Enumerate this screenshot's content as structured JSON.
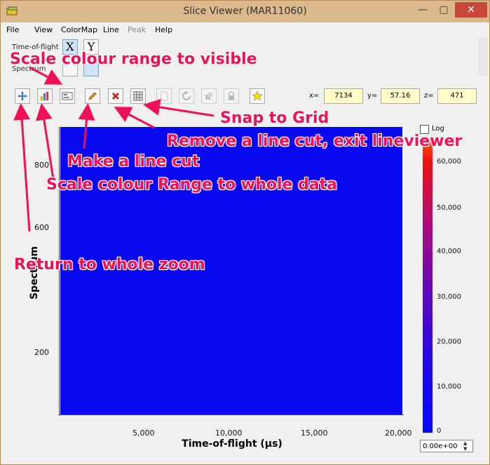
{
  "window": {
    "title": "Slice Viewer (MAR11060)",
    "minimize": "—",
    "restore": "▢",
    "close": "✕"
  },
  "menu": [
    "File",
    "View",
    "ColorMap",
    "Line",
    "Peak",
    "Help"
  ],
  "dimensions": {
    "row1_label": "Time-of-flight",
    "x_button": "X",
    "y_button": "Y",
    "row2_label": "Spectrum"
  },
  "toolbar": {
    "zoom_full": "Return to whole zoom",
    "scale_full": "Scale colour Range to whole data",
    "scale_visible": "Scale colour range to visible",
    "line_cut": "Make a line cut",
    "remove_cut": "Remove a line cut, exit lineviewer",
    "snap_grid": "Snap to Grid"
  },
  "coords": {
    "x_label": "x=",
    "x_value": "7134",
    "y_label": "y=",
    "y_value": "57.16",
    "z_label": "z=",
    "z_value": "471"
  },
  "plot": {
    "xlabel": "Time-of-flight (µs)",
    "ylabel": "Spectrum",
    "xticks": [
      "5,000",
      "10,000",
      "15,000",
      "20,000"
    ],
    "yticks": [
      "800",
      "600",
      "200"
    ]
  },
  "colorbar": {
    "log_label": "Log",
    "ticks": [
      "60,000",
      "50,000",
      "40,000",
      "30,000",
      "20,000",
      "10,000",
      "0"
    ],
    "min_value": "0.00e+00"
  },
  "annotations": {
    "scale_visible": "Scale colour range to visible",
    "snap_grid": "Snap to Grid",
    "remove_cut": "Remove a line cut, exit lineviewer",
    "line_cut": "Make a line cut",
    "scale_full": "Scale colour Range to whole data",
    "zoom_full": "Return to whole zoom"
  }
}
